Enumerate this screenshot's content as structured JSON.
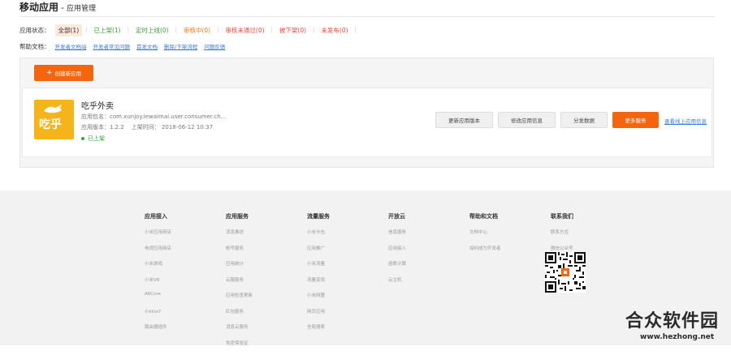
{
  "header": {
    "title": "移动应用",
    "separator": "-",
    "subtitle": "应用管理"
  },
  "status": {
    "label": "应用状态：",
    "items": [
      {
        "label": "全部(1)"
      },
      {
        "label": "已上架(1)"
      },
      {
        "label": "定时上线(0)"
      },
      {
        "label": "审核中(0)"
      },
      {
        "label": "审核未通过(0)"
      },
      {
        "label": "被下架(0)"
      },
      {
        "label": "未发布(0)"
      }
    ]
  },
  "help": {
    "label": "帮助文档：",
    "links": [
      "开发者文档站",
      "开发者常见问题",
      "首发文档",
      "删除/下架流程",
      "问题反馈"
    ]
  },
  "toolbar": {
    "create_label": "创建新应用",
    "create_icon": "plus-icon"
  },
  "app": {
    "name": "吃乎外卖",
    "icon_text": "吃乎",
    "package": "应用包名：com.xunjoy.lewaimai.user.consumer.ch...",
    "version": "应用版本：1.2.2",
    "updated": "上架时间： 2018-06-12 10:37",
    "state": "已上架",
    "actions": {
      "update_version": "更新应用版本",
      "edit_info": "修改应用信息",
      "distribution_data": "分发数据",
      "more_services": "更多服务",
      "view_online": "查看线上应用信息"
    }
  },
  "footer": {
    "columns": [
      {
        "title": "应用接入",
        "items": [
          "小米应用商店",
          "电视应用商店",
          "小米游戏",
          "小米VR",
          "ARCore",
          "小kkla7",
          "路由器插件"
        ]
      },
      {
        "title": "应用服务",
        "items": [
          "消息推送",
          "帐号服务",
          "应用统计",
          "云服服务",
          "应用检查更新",
          "红包服务",
          "消息云服务",
          "免密保验证"
        ]
      },
      {
        "title": "流量服务",
        "items": [
          "小米卡包",
          "应用推广",
          "小米流量",
          "流量变现",
          "小米网盟",
          "网页应用",
          "全局搜索"
        ]
      },
      {
        "title": "开放云",
        "items": [
          "信息服务",
          "应用接入",
          "函数计算",
          "云主机"
        ]
      },
      {
        "title": "帮助和文档",
        "items": [
          "文档中心",
          "如何成为开发者"
        ]
      },
      {
        "title": "联系我们",
        "items": [
          "联系方式",
          "微信公众号"
        ]
      }
    ]
  },
  "watermark": {
    "title": "合众软件园",
    "url": "www.hezhong.net"
  },
  "colors": {
    "accent": "#f4660e",
    "link": "#3a7bd5",
    "success": "#3aa039"
  }
}
